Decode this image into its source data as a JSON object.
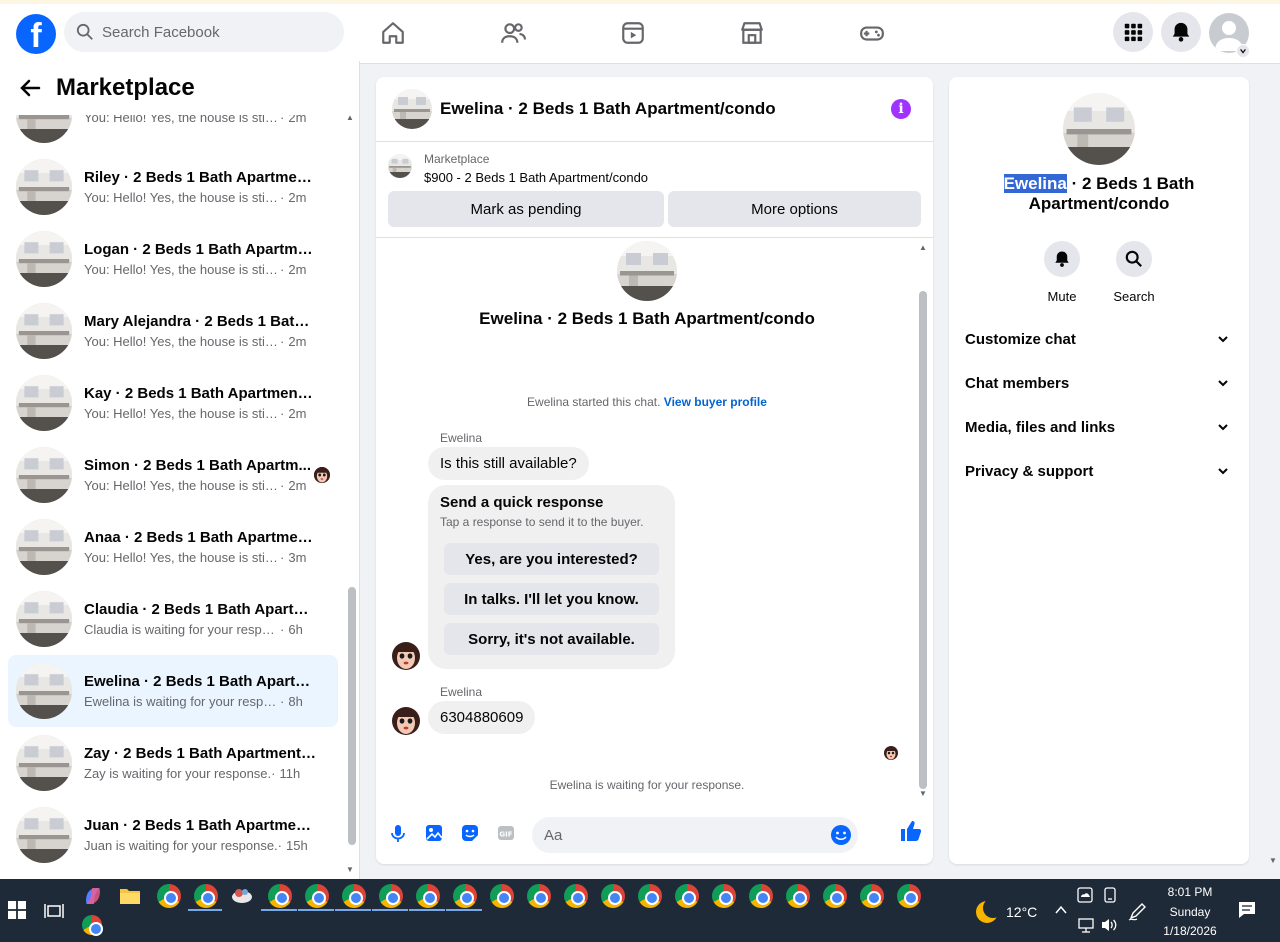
{
  "topbar": {
    "logo": "f",
    "search_placeholder": "Search Facebook",
    "nav_icons": [
      "home-icon",
      "friends-icon",
      "video-icon",
      "marketplace-icon",
      "gaming-icon"
    ],
    "right_icons": [
      "menu-grid-icon",
      "notifications-bell-icon",
      "profile-avatar"
    ]
  },
  "left": {
    "title": "Marketplace",
    "conversations": [
      {
        "name": "",
        "preview": "You: Hello! Yes, the house is still av...",
        "time": "2m"
      },
      {
        "name": "Riley · 2 Beds 1 Bath Apartment/...",
        "preview": "You: Hello! Yes, the house is still av...",
        "time": "2m"
      },
      {
        "name": "Logan · 2 Beds 1 Bath Apartmen...",
        "preview": "You: Hello! Yes, the house is still av...",
        "time": "2m"
      },
      {
        "name": "Mary Alejandra · 2 Beds 1 Bath ...",
        "preview": "You: Hello! Yes, the house is still av...",
        "time": "2m"
      },
      {
        "name": "Kay · 2 Beds 1 Bath Apartment/c...",
        "preview": "You: Hello! Yes, the house is still av...",
        "time": "2m"
      },
      {
        "name": "Simon · 2 Beds 1 Bath Apartm...",
        "preview": "You: Hello! Yes, the house is still...",
        "time": "2m"
      },
      {
        "name": "Anaa · 2 Beds 1 Bath Apartment/...",
        "preview": "You: Hello! Yes, the house is still av...",
        "time": "3m"
      },
      {
        "name": "Claudia · 2 Beds 1 Bath Apartme...",
        "preview": "Claudia is waiting for your response.",
        "time": "6h"
      },
      {
        "name": "Ewelina · 2 Beds 1 Bath Apartme...",
        "preview": "Ewelina is waiting for your response.",
        "time": "8h"
      },
      {
        "name": "Zay · 2 Beds 1 Bath Apartment/c...",
        "preview": "Zay is waiting for your response.",
        "time": "11h"
      },
      {
        "name": "Juan · 2 Beds 1 Bath Apartment/...",
        "preview": "Juan is waiting for your response.",
        "time": "15h"
      }
    ]
  },
  "chat": {
    "title": "Ewelina · 2 Beds 1 Bath Apartment/condo",
    "listing_label": "Marketplace",
    "listing_price": "$900 - 2 Beds 1 Bath Apartment/condo",
    "mark_pending": "Mark as pending",
    "more_options": "More options",
    "center_title": "Ewelina · 2 Beds 1 Bath Apartment/condo",
    "started_text": "Ewelina started this chat.",
    "view_profile": "View buyer profile",
    "sender1": "Ewelina",
    "message1": "Is this still available?",
    "quick_title": "Send a quick response",
    "quick_sub": "Tap a response to send it to the buyer.",
    "quick_options": [
      "Yes, are you interested?",
      "In talks. I'll let you know.",
      "Sorry, it's not available."
    ],
    "sender2": "Ewelina",
    "message2": "6304880609",
    "waiting": "Ewelina is waiting for your response.",
    "composer_placeholder": "Aa"
  },
  "right": {
    "name_highlight": "Ewelina",
    "title_rest": " · 2 Beds 1 Bath",
    "title_line2": "Apartment/condo",
    "mute": "Mute",
    "search": "Search",
    "sections": [
      "Customize chat",
      "Chat members",
      "Media, files and links",
      "Privacy & support"
    ]
  },
  "taskbar": {
    "temperature": "12°C",
    "time": "8:01 PM",
    "day": "Sunday",
    "date": "1/18/2026"
  },
  "colors": {
    "brand": "#0866ff",
    "active_bg": "#ebf5ff",
    "info": "#a033ff",
    "link": "#0064d1"
  }
}
